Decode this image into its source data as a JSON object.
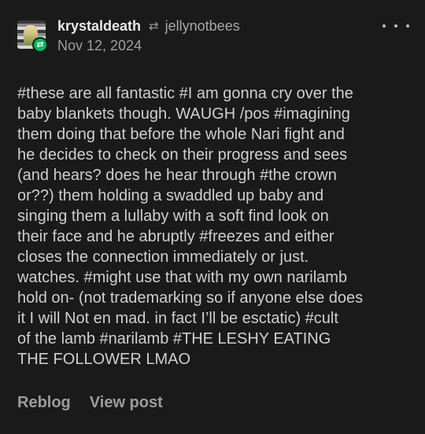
{
  "post": {
    "author": "krystaldeath",
    "reblogged_from": "jellynotbees",
    "date": "Nov 12, 2024",
    "body_lines": "#these are all fantastic  #I am gonna cry over the\nbaby blankets though. WAUGH /pos  #imagining\nthem doing that before the whole Nari fight and\nhe decides to check on their progress and sees\n(and hears? does he hear through  #the crown\nor??) them holding a swaddled up baby and\nsinging them a lullaby with a soft find look on\ntheir face and he abruptly  #freezes and either\ncloses the connection immediately or just.\nwatches.  #might use that with my own narilamb\nhold on- (not trademarking so if anyone else does\nit I will Not en mad. in fact I’ll be esctatic)  #cult\nof the lamb  #narilamb  #THE LESHY EATING\nTHE FOLLOWER LMAO"
  },
  "footer": {
    "reblog_label": "Reblog",
    "view_post_label": "View post"
  },
  "icons": {
    "reblog": "reblog-icon",
    "more": "more-options-icon",
    "badge": "reblog-badge-icon"
  },
  "colors": {
    "background": "#1a1a1a",
    "accent_green": "#00b85f",
    "text": "#cfcfcf"
  }
}
